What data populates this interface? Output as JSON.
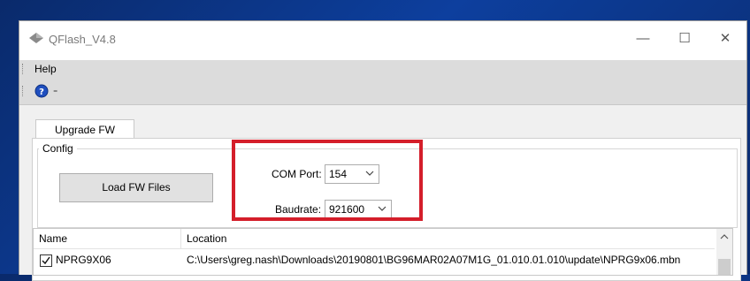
{
  "window": {
    "title": "QFlash_V4.8",
    "controls": {
      "minimize": "—",
      "maximize": "☐",
      "close": "✕"
    }
  },
  "menu": {
    "help": "Help"
  },
  "toolbar": {
    "help_icon": "help-icon",
    "overflow": "⁼"
  },
  "tabs": [
    {
      "label": "Upgrade FW",
      "selected": true
    }
  ],
  "config": {
    "group_label": "Config",
    "load_button": "Load FW Files",
    "com_port_label": "COM Port:",
    "com_port_value": "154",
    "baudrate_label": "Baudrate:",
    "baudrate_value": "921600"
  },
  "file_list": {
    "columns": [
      "Name",
      "Location"
    ],
    "rows": [
      {
        "checked": true,
        "name": "NPRG9X06",
        "location": "C:\\Users\\greg.nash\\Downloads\\20190801\\BG96MAR02A07M1G_01.010.01.010\\update\\NPRG9x06.mbn"
      }
    ]
  },
  "colors": {
    "highlight": "#d41e2a",
    "window_bg": "#f0f0f0",
    "menu_bg": "#dcdcdc",
    "desktop": "#0d3f9e"
  }
}
